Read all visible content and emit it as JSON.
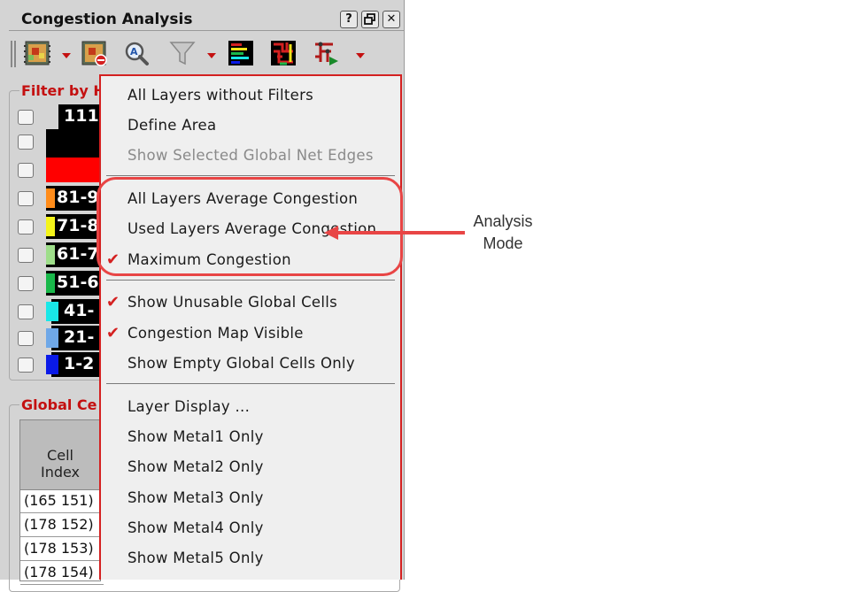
{
  "panel": {
    "title": "Congestion Analysis",
    "title_buttons": [
      {
        "icon": "help-icon",
        "glyph": "?"
      },
      {
        "icon": "restore-icon",
        "glyph": "🗗"
      },
      {
        "icon": "close-icon",
        "glyph": "✕"
      }
    ]
  },
  "toolbar": {
    "tools": [
      {
        "icon": "congestion-map-icon",
        "has_dropdown": true
      },
      {
        "icon": "congestion-map-clear-icon",
        "has_dropdown": false
      },
      {
        "icon": "zoom-icon",
        "has_dropdown": false
      },
      {
        "icon": "filter-icon",
        "has_dropdown": true
      },
      {
        "icon": "legend-icon",
        "has_dropdown": false
      },
      {
        "icon": "routing-icon",
        "has_dropdown": false
      },
      {
        "icon": "net-tree-icon",
        "has_dropdown": true
      }
    ]
  },
  "filter_group": {
    "title": "Filter by H",
    "rows": [
      {
        "label": "111",
        "color": "#000000",
        "bg": "#000000"
      },
      {
        "label": "",
        "color": "#000000",
        "bg": "#000000"
      },
      {
        "label": "",
        "color": "#ff0000",
        "bg": "#ff0000"
      },
      {
        "label": "81-9",
        "color": "#ff8c1a",
        "bg": "#000000"
      },
      {
        "label": "71-8",
        "color": "#f4f41a",
        "bg": "#000000"
      },
      {
        "label": "61-7",
        "color": "#9ede8a",
        "bg": "#000000"
      },
      {
        "label": "51-6",
        "color": "#19b84a",
        "bg": "#000000"
      },
      {
        "label": "41-",
        "color": "#19e8e8",
        "bg": "#000000"
      },
      {
        "label": "21-",
        "color": "#6fa8e8",
        "bg": "#000000"
      },
      {
        "label": "1-2",
        "color": "#0a1ae8",
        "bg": "#000000"
      }
    ]
  },
  "global_group": {
    "title": "Global Ce",
    "table": {
      "header_line1": "Cell",
      "header_line2": "Index",
      "rows": [
        "(165 151)",
        "(178 152)",
        "(178 153)",
        "(178 154)"
      ]
    }
  },
  "menu": {
    "items": [
      {
        "label": "All Layers without Filters",
        "checked": false,
        "disabled": false
      },
      {
        "label": "Define Area",
        "checked": false,
        "disabled": false
      },
      {
        "label": "Show Selected Global Net Edges",
        "checked": false,
        "disabled": true
      },
      {
        "label": "All Layers Average Congestion",
        "checked": false,
        "disabled": false
      },
      {
        "label": "Used Layers Average Congestion",
        "checked": false,
        "disabled": false
      },
      {
        "label": "Maximum Congestion",
        "checked": true,
        "disabled": false
      },
      {
        "label": "Show Unusable Global Cells",
        "checked": true,
        "disabled": false
      },
      {
        "label": "Congestion Map Visible",
        "checked": true,
        "disabled": false
      },
      {
        "label": "Show Empty Global Cells Only",
        "checked": false,
        "disabled": false
      },
      {
        "label": "Layer Display ...",
        "checked": false,
        "disabled": false
      },
      {
        "label": "Show Metal1 Only",
        "checked": false,
        "disabled": false
      },
      {
        "label": "Show Metal2 Only",
        "checked": false,
        "disabled": false
      },
      {
        "label": "Show Metal3 Only",
        "checked": false,
        "disabled": false
      },
      {
        "label": "Show Metal4 Only",
        "checked": false,
        "disabled": false
      },
      {
        "label": "Show Metal5 Only",
        "checked": false,
        "disabled": false
      }
    ],
    "check_glyph": "✔"
  },
  "annotation": {
    "line1": "Analysis",
    "line2": "Mode",
    "color": "#e84545"
  }
}
